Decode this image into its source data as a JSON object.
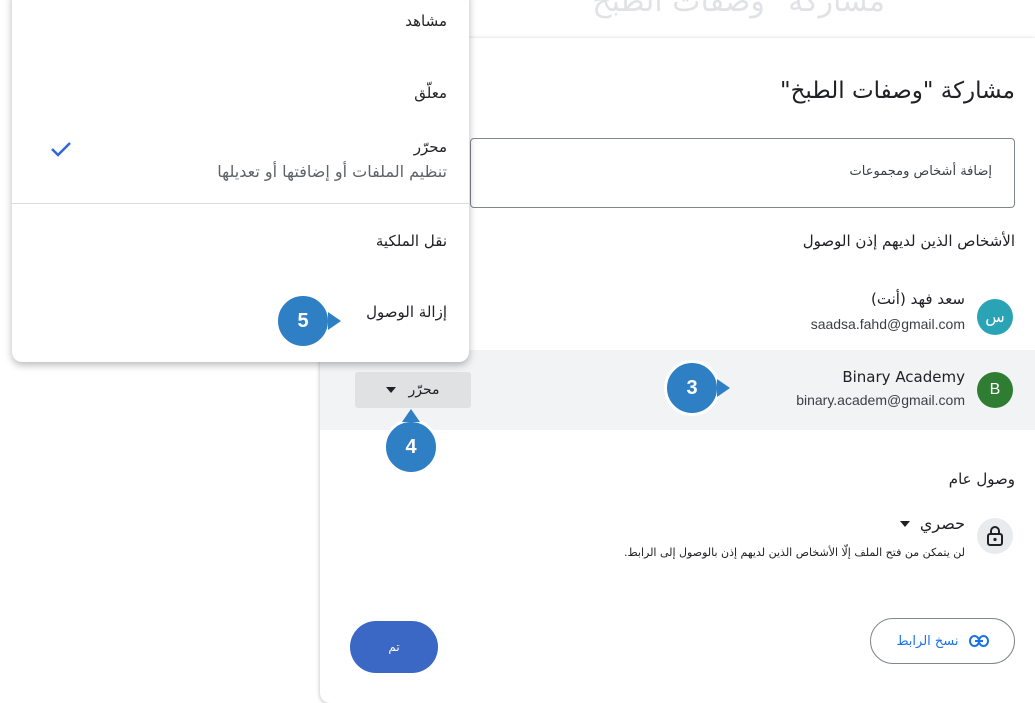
{
  "background": {
    "faded_title": "مشاركة \"وصفات الطبخ\""
  },
  "dialog": {
    "title": "مشاركة \"وصفات الطبخ\"",
    "add_people_placeholder": "إضافة أشخاص ومجموعات",
    "people_with_access_label": "الأشخاص الذين لديهم إذن الوصول",
    "people": [
      {
        "name": "سعد فهد (أنت)",
        "email": "saadsa.fahd@gmail.com",
        "avatar_letter": "س",
        "avatar_color": "#2aa3b4"
      },
      {
        "name": "Binary Academy",
        "email": "binary.academ@gmail.com",
        "avatar_letter": "B",
        "avatar_color": "#2e7d32",
        "role": "محرّر"
      }
    ],
    "general_access_label": "وصول عام",
    "access_mode": "حصري",
    "access_description": "لن يتمكن من فتح الملف إلّا الأشخاص الذين لديهم إذن بالوصول إلى الرابط.",
    "copy_link_label": "نسخ الرابط",
    "done_label": "تم"
  },
  "role_menu": {
    "items": [
      {
        "label": "مشاهد"
      },
      {
        "label": "معلّق"
      },
      {
        "label": "محرّر",
        "description": "تنظيم الملفات أو إضافتها أو تعديلها",
        "selected": true
      },
      {
        "label": "نقل الملكية"
      },
      {
        "label": "إزالة الوصول"
      }
    ]
  },
  "callouts": {
    "step3": "3",
    "step4": "4",
    "step5": "5"
  },
  "colors": {
    "accent": "#1a73e8",
    "callout": "#2f7fc4",
    "done_button": "#3a68c4"
  }
}
